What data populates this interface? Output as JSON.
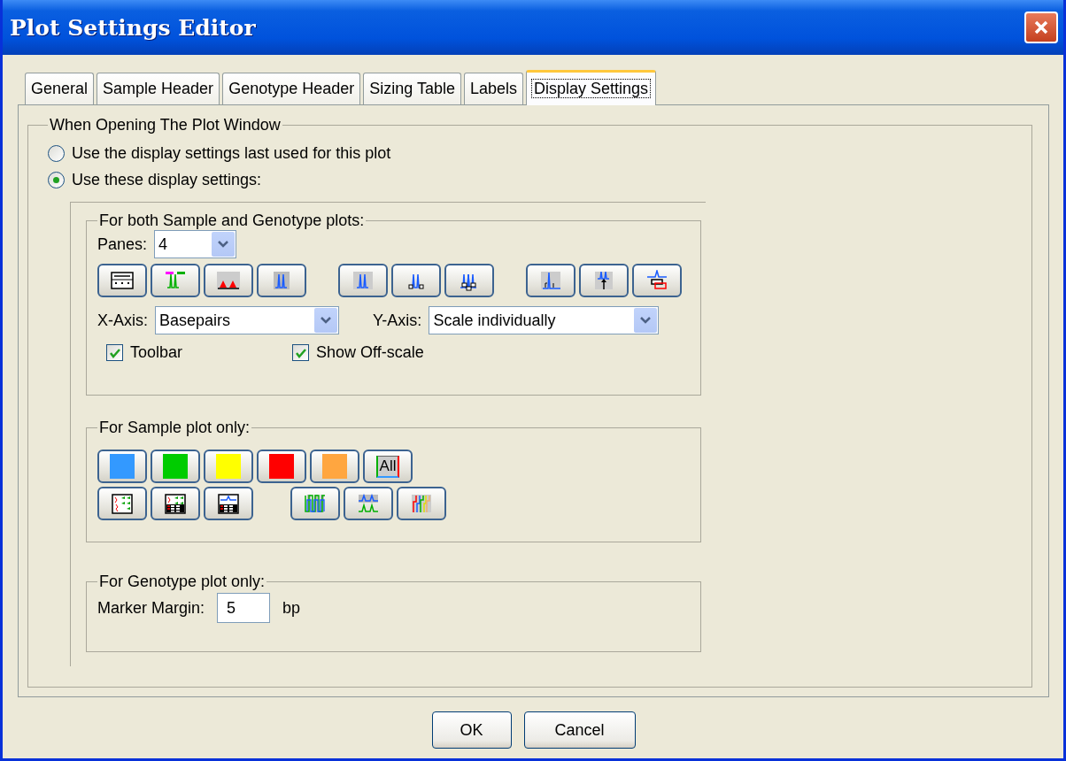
{
  "window": {
    "title": "Plot Settings Editor"
  },
  "tabs": [
    {
      "label": "General",
      "selected": false
    },
    {
      "label": "Sample Header",
      "selected": false
    },
    {
      "label": "Genotype Header",
      "selected": false
    },
    {
      "label": "Sizing Table",
      "selected": false
    },
    {
      "label": "Labels",
      "selected": false
    },
    {
      "label": "Display Settings",
      "selected": true
    }
  ],
  "section": {
    "title": "When Opening The Plot Window",
    "options": [
      {
        "label": "Use the display settings last used for this plot",
        "selected": false
      },
      {
        "label": "Use these display settings:",
        "selected": true
      }
    ]
  },
  "both_plots": {
    "title": "For both Sample and Genotype plots:",
    "panes": {
      "label": "Panes:",
      "value": "4"
    },
    "x_axis": {
      "label": "X-Axis:",
      "value": "Basepairs"
    },
    "y_axis": {
      "label": "Y-Axis:",
      "value": "Scale individually"
    },
    "checkboxes": [
      {
        "label": "Toolbar",
        "checked": true
      },
      {
        "label": "Show Off-scale",
        "checked": true
      }
    ]
  },
  "sample_plot": {
    "title": "For Sample plot only:",
    "color_buttons": [
      {
        "color": "#3399ff"
      },
      {
        "color": "#00cc00"
      },
      {
        "color": "#ffff00"
      },
      {
        "color": "#ff0000"
      },
      {
        "color": "#ffa640"
      }
    ],
    "all_button": {
      "label": "All"
    }
  },
  "genotype_plot": {
    "title": "For Genotype plot only:",
    "marker_margin": {
      "label": "Marker Margin:",
      "value": "5",
      "unit": "bp"
    }
  },
  "buttons": [
    "OK",
    "Cancel"
  ]
}
